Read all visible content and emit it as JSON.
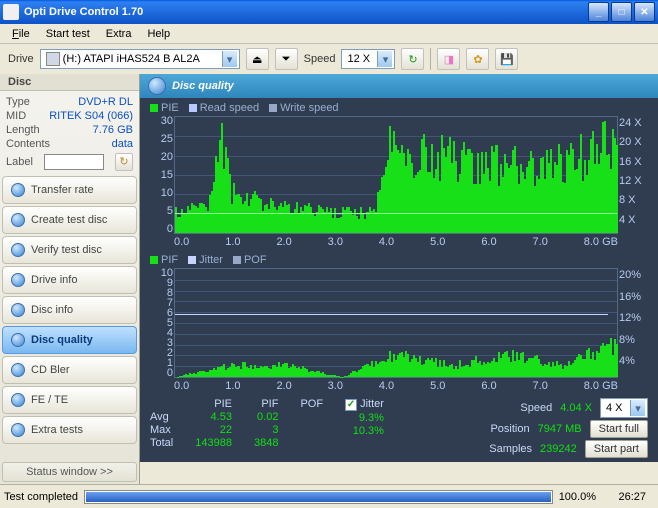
{
  "window": {
    "title": "Opti Drive Control 1.70"
  },
  "menu": {
    "file": "File",
    "start": "Start test",
    "extra": "Extra",
    "help": "Help"
  },
  "toolbar": {
    "drive": "Drive",
    "drive_sel": "(H:)  ATAPI   iHAS524   B AL2A",
    "speed": "Speed",
    "speed_sel": "12 X"
  },
  "disc": {
    "header": "Disc",
    "type_lbl": "Type",
    "type": "DVD+R DL",
    "mid_lbl": "MID",
    "mid": "RITEK S04 (066)",
    "len_lbl": "Length",
    "len": "7.76 GB",
    "cont_lbl": "Contents",
    "cont": "data",
    "label_lbl": "Label"
  },
  "sidebar": {
    "items": [
      {
        "label": "Transfer rate"
      },
      {
        "label": "Create test disc"
      },
      {
        "label": "Verify test disc"
      },
      {
        "label": "Drive info"
      },
      {
        "label": "Disc info"
      },
      {
        "label": "Disc quality"
      },
      {
        "label": "CD Bler"
      },
      {
        "label": "FE / TE"
      },
      {
        "label": "Extra tests"
      }
    ],
    "status_toggle": "Status window >>"
  },
  "content": {
    "title": "Disc quality",
    "legend1": {
      "pie": "PIE",
      "read": "Read speed",
      "write": "Write speed"
    },
    "legend2": {
      "pif": "PIF",
      "jitter": "Jitter",
      "pof": "POF"
    },
    "top_y": [
      "30",
      "25",
      "20",
      "15",
      "10",
      "5",
      "0"
    ],
    "top_ry": [
      "24 X",
      "20 X",
      "16 X",
      "12 X",
      "8 X",
      "4 X",
      ""
    ],
    "x": [
      "0.0",
      "1.0",
      "2.0",
      "3.0",
      "4.0",
      "5.0",
      "6.0",
      "7.0",
      "8.0 GB"
    ],
    "bot_y": [
      "10",
      "9",
      "8",
      "7",
      "6",
      "5",
      "4",
      "3",
      "2",
      "1",
      "0"
    ],
    "bot_ry": [
      "20%",
      "16%",
      "12%",
      "8%",
      "4%",
      ""
    ],
    "stats": {
      "rows": [
        "Avg",
        "Max",
        "Total"
      ],
      "pie_lbl": "PIE",
      "pie": [
        "4.53",
        "22",
        "143988"
      ],
      "pif_lbl": "PIF",
      "pif": [
        "0.02",
        "3",
        "3848"
      ],
      "pof_lbl": "POF",
      "pof": [
        "",
        "",
        ""
      ],
      "jitter_lbl": "Jitter",
      "jitter": [
        "9.3%",
        "10.3%",
        ""
      ],
      "speed_lbl": "Speed",
      "speed": "4.04 X",
      "pos_lbl": "Position",
      "pos": "7947 MB",
      "samp_lbl": "Samples",
      "samp": "239242",
      "speed_sel": "4 X",
      "start_full": "Start full",
      "start_part": "Start part"
    }
  },
  "status": {
    "msg": "Test completed",
    "pct": "100.0%",
    "time": "26:27"
  },
  "chart_data": [
    {
      "type": "bar",
      "title": "PIE vs position",
      "xlabel": "GB",
      "ylabel": "PIE",
      "ylim": [
        0,
        30
      ],
      "ry_label": "Speed X",
      "rylim": [
        0,
        24
      ],
      "x_range": [
        0,
        8
      ],
      "series": [
        {
          "name": "PIE",
          "approx_profile": [
            {
              "x": 0.0,
              "v": 5
            },
            {
              "x": 0.6,
              "v": 7
            },
            {
              "x": 0.8,
              "v": 24
            },
            {
              "x": 1.0,
              "v": 10
            },
            {
              "x": 2.0,
              "v": 6
            },
            {
              "x": 3.0,
              "v": 5
            },
            {
              "x": 3.6,
              "v": 5
            },
            {
              "x": 3.8,
              "v": 20
            },
            {
              "x": 5.0,
              "v": 18
            },
            {
              "x": 6.0,
              "v": 16
            },
            {
              "x": 7.0,
              "v": 17
            },
            {
              "x": 7.8,
              "v": 22
            },
            {
              "x": 8.0,
              "v": 18
            }
          ]
        },
        {
          "name": "Read speed",
          "approx_profile": [
            {
              "x": 0,
              "v": 4
            },
            {
              "x": 8,
              "v": 4
            }
          ]
        }
      ]
    },
    {
      "type": "bar",
      "title": "PIF / Jitter vs position",
      "xlabel": "GB",
      "ylabel": "PIF",
      "ylim": [
        0,
        10
      ],
      "ry_label": "%",
      "rylim": [
        0,
        20
      ],
      "x_range": [
        0,
        8
      ],
      "series": [
        {
          "name": "PIF",
          "approx_profile": [
            {
              "x": 0,
              "v": 0
            },
            {
              "x": 1,
              "v": 1
            },
            {
              "x": 2,
              "v": 1
            },
            {
              "x": 3,
              "v": 0
            },
            {
              "x": 4,
              "v": 2
            },
            {
              "x": 5,
              "v": 1
            },
            {
              "x": 6,
              "v": 2
            },
            {
              "x": 7,
              "v": 1
            },
            {
              "x": 8,
              "v": 3
            }
          ]
        },
        {
          "name": "Jitter",
          "approx_profile": [
            {
              "x": 0,
              "v": 9.0
            },
            {
              "x": 3.7,
              "v": 8.8
            },
            {
              "x": 3.8,
              "v": 10.2
            },
            {
              "x": 8,
              "v": 9.6
            }
          ]
        }
      ]
    }
  ]
}
